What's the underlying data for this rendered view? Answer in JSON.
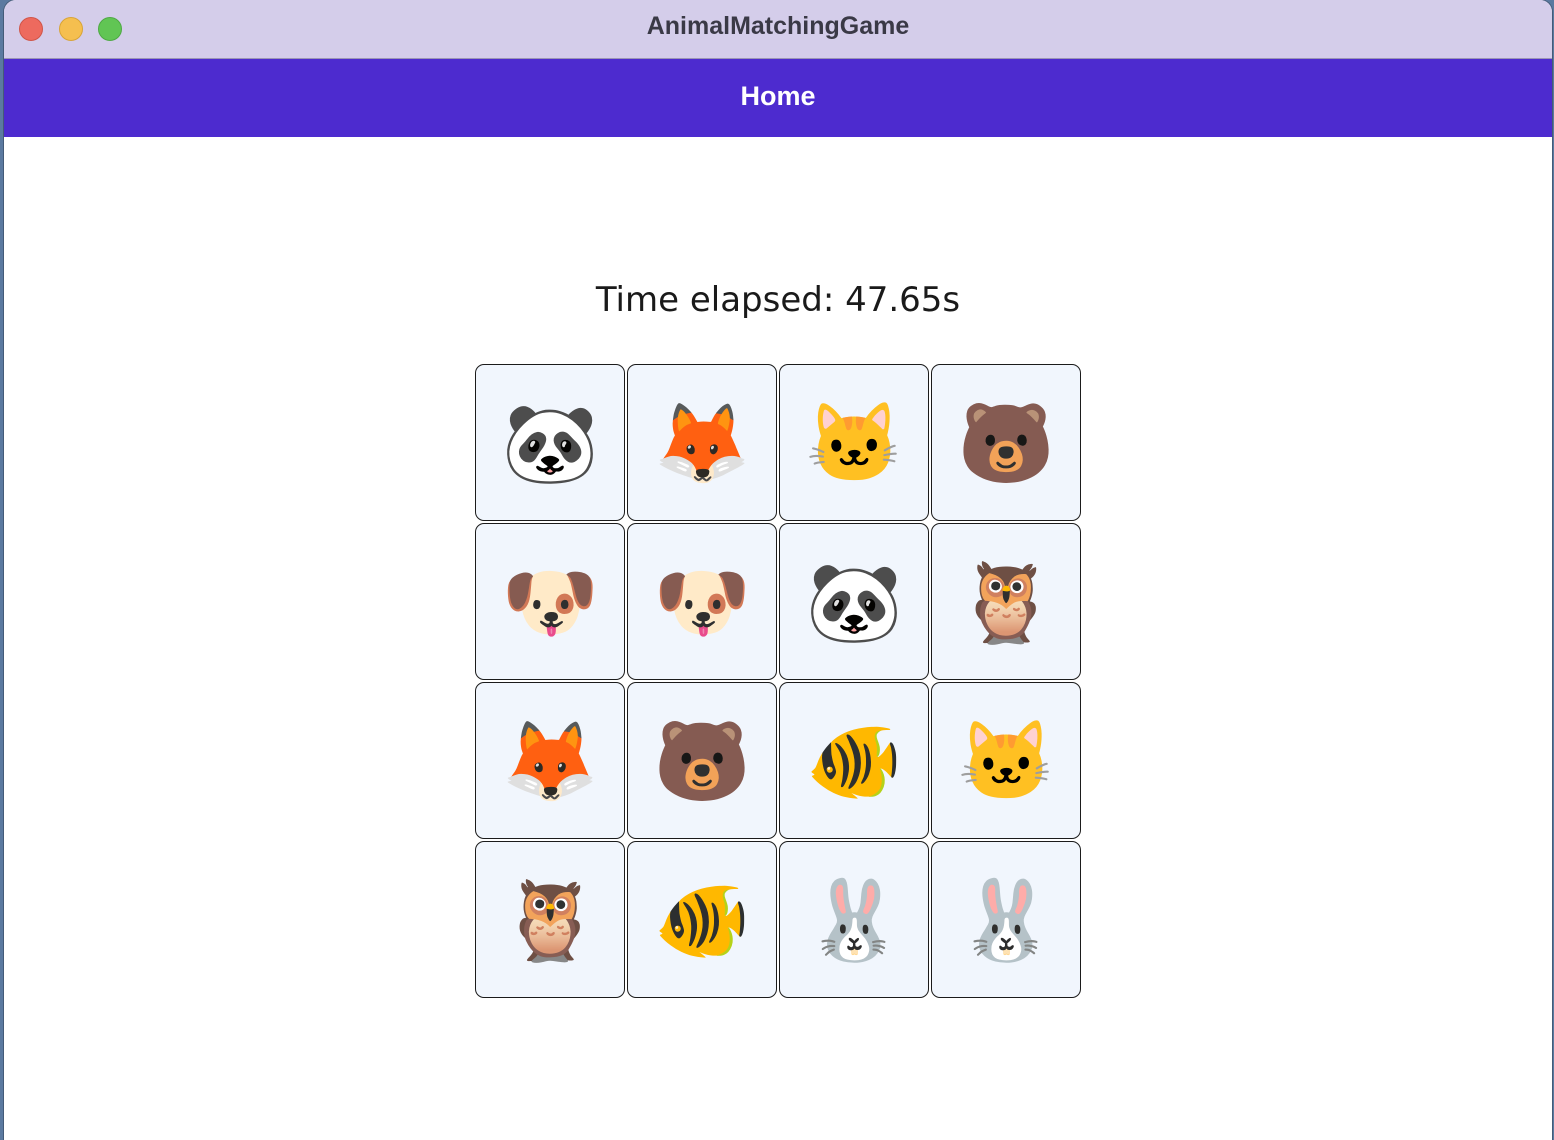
{
  "window": {
    "title": "AnimalMatchingGame"
  },
  "nav": {
    "title": "Home"
  },
  "timer": {
    "text": "Time elapsed: 47.65s"
  },
  "cards": [
    {
      "animal": "panda",
      "emoji": "🐼"
    },
    {
      "animal": "fox",
      "emoji": "🦊"
    },
    {
      "animal": "cat",
      "emoji": "🐱"
    },
    {
      "animal": "bear",
      "emoji": "🐻"
    },
    {
      "animal": "dog",
      "emoji": "🐶"
    },
    {
      "animal": "dog",
      "emoji": "🐶"
    },
    {
      "animal": "panda",
      "emoji": "🐼"
    },
    {
      "animal": "owl",
      "emoji": "🦉"
    },
    {
      "animal": "fox",
      "emoji": "🦊"
    },
    {
      "animal": "bear",
      "emoji": "🐻"
    },
    {
      "animal": "tropical-fish",
      "emoji": "🐠"
    },
    {
      "animal": "cat",
      "emoji": "🐱"
    },
    {
      "animal": "owl",
      "emoji": "🦉"
    },
    {
      "animal": "tropical-fish",
      "emoji": "🐠"
    },
    {
      "animal": "rabbit",
      "emoji": "🐰"
    },
    {
      "animal": "rabbit",
      "emoji": "🐰"
    }
  ],
  "colors": {
    "titlebar": "#d4cdea",
    "navbar": "#4d2bcf",
    "card_bg": "#f1f6fd",
    "close": "#ed6a5e",
    "minimize": "#f5bf4f",
    "maximize": "#61c554"
  }
}
